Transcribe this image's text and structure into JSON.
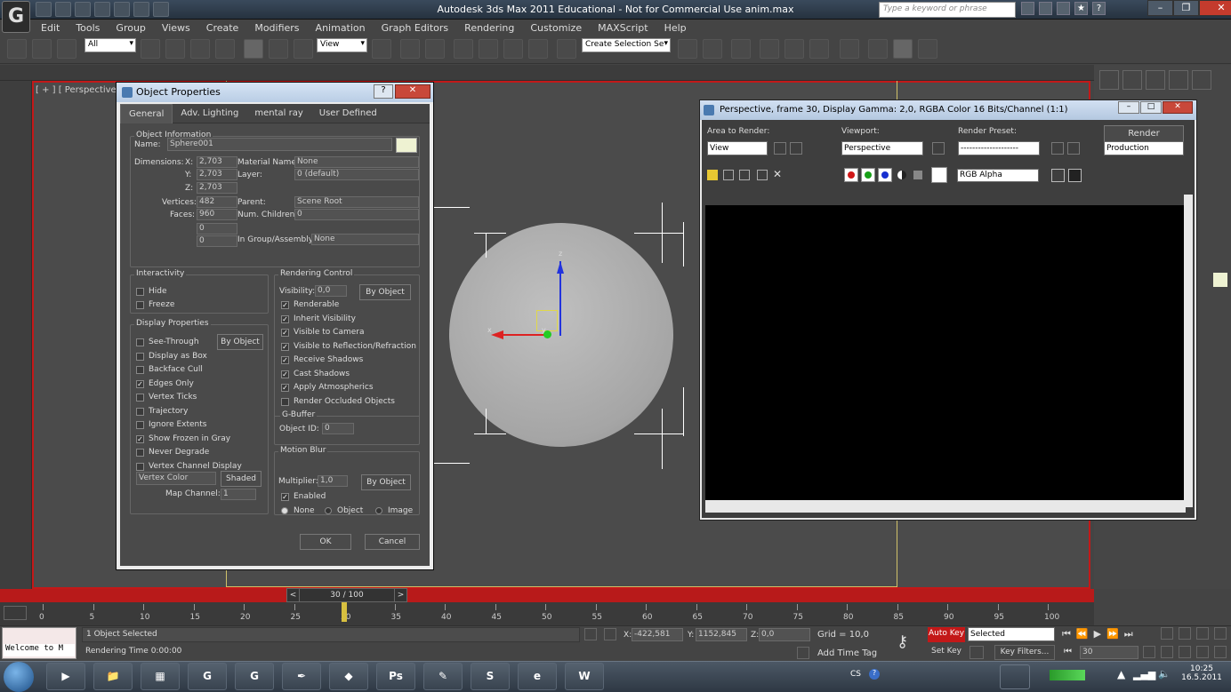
{
  "app": {
    "title": "Autodesk 3ds Max  2011    Educational - Not for Commercial Use    anim.max",
    "logo": "G",
    "search_placeholder": "Type a keyword or phrase"
  },
  "menu": [
    "Edit",
    "Tools",
    "Group",
    "Views",
    "Create",
    "Modifiers",
    "Animation",
    "Graph Editors",
    "Rendering",
    "Customize",
    "MAXScript",
    "Help"
  ],
  "toolbar": {
    "selection_filter": "All",
    "ref_coord": "View",
    "named_selection": "Create Selection Se"
  },
  "viewport": {
    "label": "[ + ] [ Perspective ] [ Shaded ]",
    "label_short": "[ + ] [ Perspective ]"
  },
  "object_properties": {
    "title": "Object Properties",
    "tabs": [
      "General",
      "Adv. Lighting",
      "mental ray",
      "User Defined"
    ],
    "active_tab": "General",
    "object_information": {
      "group_title": "Object Information",
      "name_label": "Name:",
      "name": "Sphere001",
      "dimensions_label": "Dimensions:",
      "x_label": "X:",
      "x": "2,703",
      "y_label": "Y:",
      "y": "2,703",
      "z_label": "Z:",
      "z": "2,703",
      "vertices_label": "Vertices:",
      "vertices": "482",
      "faces_label": "Faces:",
      "faces": "960",
      "extra1": "0",
      "extra2": "0",
      "material_label": "Material Name:",
      "material": "None",
      "layer_label": "Layer:",
      "layer": "0 (default)",
      "parent_label": "Parent:",
      "parent": "Scene Root",
      "children_label": "Num. Children:",
      "children": "0",
      "group_label": "In Group/Assembly:",
      "group": "None"
    },
    "interactivity": {
      "title": "Interactivity",
      "hide": "Hide",
      "freeze": "Freeze"
    },
    "display_properties": {
      "title": "Display Properties",
      "by_object": "By Object",
      "items": [
        {
          "label": "See-Through",
          "checked": false
        },
        {
          "label": "Display as Box",
          "checked": false
        },
        {
          "label": "Backface Cull",
          "checked": false
        },
        {
          "label": "Edges Only",
          "checked": true
        },
        {
          "label": "Vertex Ticks",
          "checked": false
        },
        {
          "label": "Trajectory",
          "checked": false
        },
        {
          "label": "Ignore Extents",
          "checked": false
        },
        {
          "label": "Show Frozen in Gray",
          "checked": true
        },
        {
          "label": "Never Degrade",
          "checked": false
        },
        {
          "label": "Vertex Channel Display",
          "checked": false
        }
      ],
      "vertex_color": "Vertex Color",
      "shaded": "Shaded",
      "map_channel_label": "Map Channel:",
      "map_channel": "1"
    },
    "rendering_control": {
      "title": "Rendering Control",
      "visibility_label": "Visibility:",
      "visibility": "0,0",
      "by_object": "By Object",
      "items": [
        {
          "label": "Renderable",
          "checked": true
        },
        {
          "label": "Inherit Visibility",
          "checked": true
        },
        {
          "label": "Visible to Camera",
          "checked": true
        },
        {
          "label": "Visible to Reflection/Refraction",
          "checked": true
        },
        {
          "label": "Receive Shadows",
          "checked": true
        },
        {
          "label": "Cast Shadows",
          "checked": true
        },
        {
          "label": "Apply Atmospherics",
          "checked": true
        },
        {
          "label": "Render Occluded Objects",
          "checked": false
        }
      ],
      "gbuffer_title": "G-Buffer",
      "object_id_label": "Object ID:",
      "object_id": "0"
    },
    "motion_blur": {
      "title": "Motion Blur",
      "multiplier_label": "Multiplier:",
      "multiplier": "1,0",
      "by_object": "By Object",
      "enabled": "Enabled",
      "none": "None",
      "object": "Object",
      "image": "Image"
    },
    "ok": "OK",
    "cancel": "Cancel"
  },
  "render_window": {
    "title": "Perspective, frame 30, Display Gamma: 2,0, RGBA Color 16 Bits/Channel (1:1)",
    "area_label": "Area to Render:",
    "area": "View",
    "viewport_label": "Viewport:",
    "viewport": "Perspective",
    "preset_label": "Render Preset:",
    "preset": "--------------------",
    "render_btn": "Render",
    "production": "Production",
    "channel": "RGB Alpha"
  },
  "timeline": {
    "slider": "30 / 100",
    "ticks": [
      "0",
      "5",
      "10",
      "15",
      "20",
      "25",
      "30",
      "35",
      "40",
      "45",
      "50",
      "55",
      "60",
      "65",
      "70",
      "75",
      "80",
      "85",
      "90",
      "95",
      "100"
    ]
  },
  "status": {
    "listener": "Welcome to M",
    "selected": "1 Object Selected",
    "rendering_time": "Rendering Time  0:00:00",
    "x_label": "X:",
    "x": "-422,581",
    "y_label": "Y:",
    "y": "1152,845",
    "z_label": "Z:",
    "z": "0,0",
    "grid": "Grid = 10,0",
    "add_time_tag": "Add Time Tag",
    "auto_key": "Auto Key",
    "selected_set": "Selected",
    "set_key": "Set Key",
    "key_filters": "Key Filters...",
    "frame": "30"
  },
  "taskbar": {
    "lang": "CS",
    "time": "10:25",
    "date": "16.5.2011",
    "apps": [
      "▶",
      "📁",
      "▦",
      "G",
      "G",
      "✒",
      "◆",
      "Ps",
      "✎",
      "S",
      "e",
      "W"
    ]
  },
  "colors": {
    "viewport_border": "#c31818",
    "auto_key": "#c31818",
    "name_swatch": "#eef2d2"
  }
}
